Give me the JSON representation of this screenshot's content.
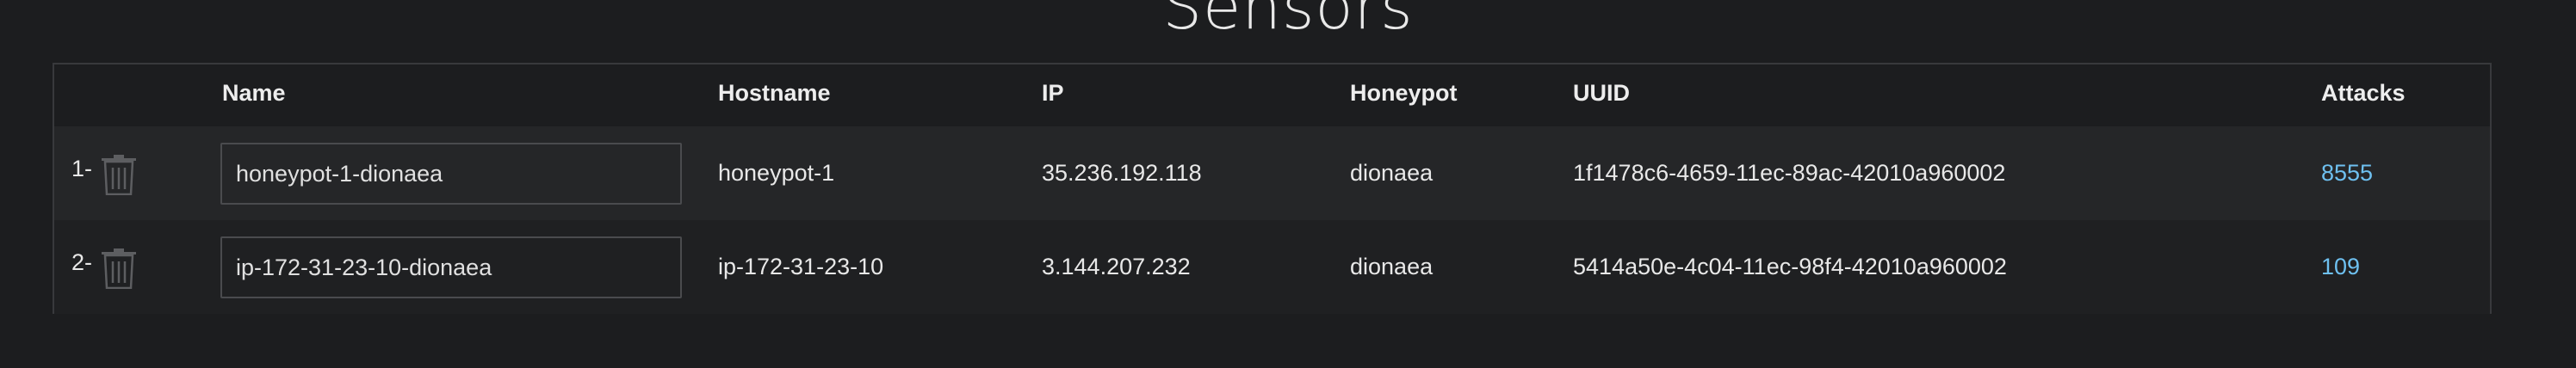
{
  "page": {
    "title": "Sensors"
  },
  "table": {
    "headers": {
      "name": "Name",
      "hostname": "Hostname",
      "ip": "IP",
      "honeypot": "Honeypot",
      "uuid": "UUID",
      "attacks": "Attacks"
    },
    "rows": [
      {
        "index": "1-",
        "name": "honeypot-1-dionaea",
        "hostname": "honeypot-1",
        "ip": "35.236.192.118",
        "honeypot": "dionaea",
        "uuid": "1f1478c6-4659-11ec-89ac-42010a960002",
        "attacks": "8555"
      },
      {
        "index": "2-",
        "name": "ip-172-31-23-10-dionaea",
        "hostname": "ip-172-31-23-10",
        "ip": "3.144.207.232",
        "honeypot": "dionaea",
        "uuid": "5414a50e-4c04-11ec-98f4-42010a960002",
        "attacks": "109"
      }
    ]
  },
  "icons": {
    "delete": "trash-icon"
  },
  "colors": {
    "background": "#1c1d1f",
    "link": "#6ec0f0",
    "border": "#38393c"
  }
}
